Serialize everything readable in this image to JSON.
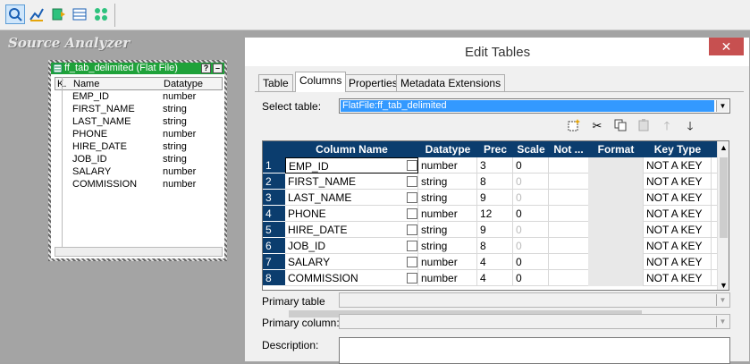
{
  "workspace": {
    "title": "Source Analyzer"
  },
  "source": {
    "title": "ff_tab_delimited (Flat File)",
    "col_key": "K.",
    "col_name": "Name",
    "col_type": "Datatype",
    "rows": [
      {
        "name": "EMP_ID",
        "type": "number"
      },
      {
        "name": "FIRST_NAME",
        "type": "string"
      },
      {
        "name": "LAST_NAME",
        "type": "string"
      },
      {
        "name": "PHONE",
        "type": "number"
      },
      {
        "name": "HIRE_DATE",
        "type": "string"
      },
      {
        "name": "JOB_ID",
        "type": "string"
      },
      {
        "name": "SALARY",
        "type": "number"
      },
      {
        "name": "COMMISSION",
        "type": "number"
      }
    ]
  },
  "dialog": {
    "title": "Edit Tables",
    "close": "✕",
    "tabs": [
      "Table",
      "Columns",
      "Properties",
      "Metadata Extensions"
    ],
    "active_tab": "Columns",
    "select_table_label": "Select table:",
    "select_table_value": "FlatFile:ff_tab_delimited",
    "primary_table_label": "Primary table",
    "primary_column_label": "Primary column:",
    "description_label": "Description:"
  },
  "grid": {
    "headers": [
      "Column Name",
      "Datatype",
      "Prec",
      "Scale",
      "Not ...",
      "Format",
      "Key Type"
    ],
    "rows": [
      {
        "n": "1",
        "name": "EMP_ID",
        "type": "number",
        "prec": "3",
        "scale": "0",
        "key": "NOT A KEY"
      },
      {
        "n": "2",
        "name": "FIRST_NAME",
        "type": "string",
        "prec": "8",
        "scale": "0",
        "key": "NOT A KEY"
      },
      {
        "n": "3",
        "name": "LAST_NAME",
        "type": "string",
        "prec": "9",
        "scale": "0",
        "key": "NOT A KEY"
      },
      {
        "n": "4",
        "name": "PHONE",
        "type": "number",
        "prec": "12",
        "scale": "0",
        "key": "NOT A KEY"
      },
      {
        "n": "5",
        "name": "HIRE_DATE",
        "type": "string",
        "prec": "9",
        "scale": "0",
        "key": "NOT A KEY"
      },
      {
        "n": "6",
        "name": "JOB_ID",
        "type": "string",
        "prec": "8",
        "scale": "0",
        "key": "NOT A KEY"
      },
      {
        "n": "7",
        "name": "SALARY",
        "type": "number",
        "prec": "4",
        "scale": "0",
        "key": "NOT A KEY"
      },
      {
        "n": "8",
        "name": "COMMISSION",
        "type": "number",
        "prec": "4",
        "scale": "0",
        "key": "NOT A KEY"
      }
    ]
  },
  "colors": {
    "grid_header": "#0b3d6e",
    "selection": "#3399ff",
    "source_header": "#1fa23a",
    "close_button": "#c75050"
  },
  "icons": [
    "new-column-icon",
    "cut-icon",
    "copy-icon",
    "paste-icon",
    "move-up-icon",
    "move-down-icon"
  ]
}
